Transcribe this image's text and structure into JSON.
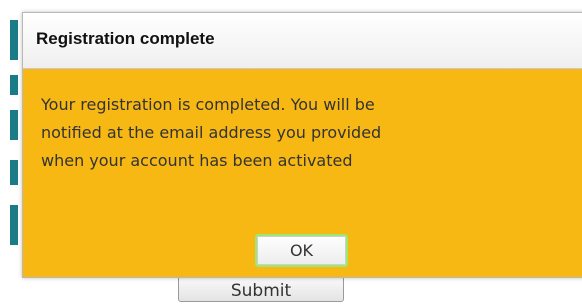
{
  "dialog": {
    "title": "Registration complete",
    "message_lines": [
      "Your registration is completed.  You will be",
      "notified at the email address you provided",
      "when your account has been activated"
    ],
    "ok_label": "OK"
  },
  "background": {
    "submit_label": "Submit"
  },
  "colors": {
    "dialog_body": "#f7b814",
    "accent_strip": "#1b7b86",
    "ok_focus_border": "#9de86e"
  }
}
